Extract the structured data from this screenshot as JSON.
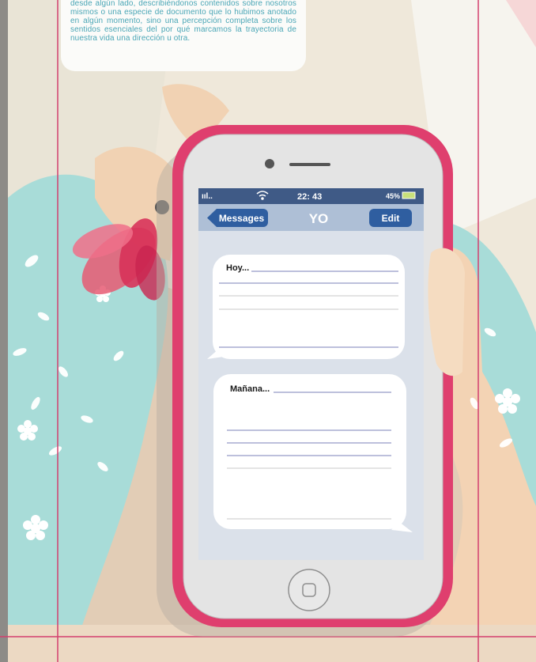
{
  "intro": {
    "paragraph": "ncuentra el Proyecto de Vida no es una ruta que nos llega desde algún lado, describiéndonos contenidos sobre nosotros mismos o una especie de documento que lo hubimos anotado en algún momento, sino una percepción completa sobre los sentidos esenciales del por qué marcamos la trayectoria de nuestra vida una dirección u otra."
  },
  "phone": {
    "status_bar": {
      "signal": "ııl..",
      "time": "22: 43",
      "battery": "45%"
    },
    "nav": {
      "back_label": "Messages",
      "title": "YO",
      "edit_label": "Edit"
    },
    "bubbles": [
      {
        "label": "Hoy..."
      },
      {
        "label": "Mañana..."
      }
    ]
  },
  "colors": {
    "phone_case": "#df3f6e",
    "header_bar": "#3f5a86",
    "nav_bar": "#aebfd6",
    "button": "#2f5ea0",
    "screen_bg": "#dbe1ea",
    "mint": "#9fd9d6",
    "skin": "#f3d3b4",
    "guide_line": "#d3406f"
  }
}
